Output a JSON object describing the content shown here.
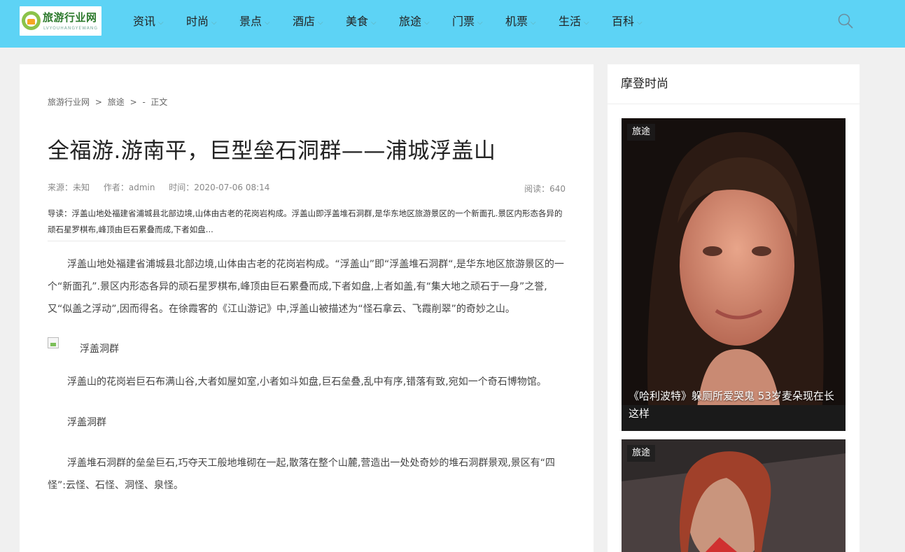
{
  "header": {
    "logo_text": "旅游行业网",
    "logo_sub": "LVYOUHANGYEWANG",
    "nav": [
      "资讯",
      "时尚",
      "景点",
      "酒店",
      "美食",
      "旅途",
      "门票",
      "机票",
      "生活",
      "百科"
    ],
    "icons": {
      "nav_dropdown": "chevron-down-icon",
      "search": "search-icon"
    },
    "colors": {
      "bar": "#5dd3f5"
    }
  },
  "breadcrumb": {
    "home": "旅游行业网",
    "sep": ">",
    "category": "旅途",
    "sep2": ">",
    "trail": "-  正文"
  },
  "article": {
    "title": "全福游.游南平，巨型垒石洞群——浦城浮盖山",
    "source": "来源：未知",
    "author": "作者：admin",
    "time": "时间：2020-07-06 08:14",
    "reads": "阅读：640",
    "lead": "导读：浮盖山地处福建省浦城县北部边境,山体由古老的花岗岩构成。浮盖山即浮盖堆石洞群,是华东地区旅游景区的一个新面孔.景区内形态各异的顽石星罗棋布,峰顶由巨石累叠而成,下者如盘...",
    "para1": "浮盖山地处福建省浦城县北部边境,山体由古老的花岗岩构成。“浮盖山”即“浮盖堆石洞群“,是华东地区旅游景区的一个“新面孔”.景区内形态各异的顽石星罗棋布,峰顶由巨石累叠而成,下者如盘,上者如盖,有“集大地之顽石于一身”之誉,又“似盖之浮动”,因而得名。在徐霞客的《江山游记》中,浮盖山被描述为“怪石拿云、飞霞削翠”的奇妙之山。",
    "figure_caption": "浮盖洞群",
    "para2": "浮盖山的花岗岩巨石布满山谷,大者如屋如室,小者如斗如盘,巨石垒叠,乱中有序,错落有致,宛如一个奇石博物馆。",
    "para3": "浮盖洞群",
    "para4": "浮盖堆石洞群的垒垒巨石,巧夺天工般地堆砌在一起,散落在整个山麓,营造出一处处奇妙的堆石洞群景观,景区有“四怪”:云怪、石怪、洞怪、泉怪。"
  },
  "sidebar": {
    "heading": "摩登时尚",
    "cards": [
      {
        "tag": "旅途",
        "title": "《哈利波特》躲厕所爱哭鬼 53岁麦朵现在长这样"
      },
      {
        "tag": "旅途",
        "title": ""
      }
    ]
  }
}
